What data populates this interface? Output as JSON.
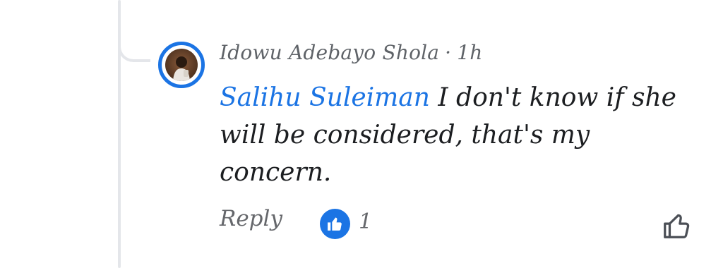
{
  "comment": {
    "author": "Idowu Adebayo Shola",
    "separator": "·",
    "time": "1h",
    "mention": "Salihu Suleiman",
    "text": "I don't know if she will be considered, that's my concern."
  },
  "actions": {
    "reply_label": "Reply",
    "reaction_count": "1",
    "reaction_icon": "thumbs-up-icon",
    "like_icon": "thumbs-up-outline-icon"
  },
  "colors": {
    "accent": "#1b74e4",
    "text": "#1c1e21",
    "secondary": "#65676b",
    "thread_line": "#e4e6ea"
  }
}
